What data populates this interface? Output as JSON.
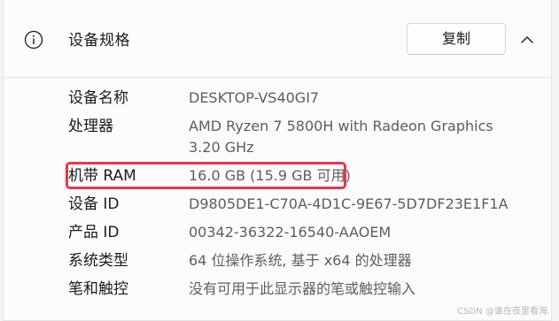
{
  "header": {
    "title": "设备规格",
    "copy_label": "复制",
    "info_icon": "info-icon",
    "collapse_icon": "chevron-up-icon"
  },
  "specs": [
    {
      "label": "设备名称",
      "value": "DESKTOP-VS40GI7"
    },
    {
      "label": "处理器",
      "value": "AMD Ryzen 7 5800H with Radeon Graphics",
      "value_line2": "3.20 GHz"
    },
    {
      "label": "机带 RAM",
      "value": "16.0 GB (15.9 GB 可用)"
    },
    {
      "label": "设备 ID",
      "value": "D9805DE1-C70A-4D1C-9E67-5D7DF23E1F1A"
    },
    {
      "label": "产品 ID",
      "value": "00342-36322-16540-AAOEM"
    },
    {
      "label": "系统类型",
      "value": "64 位操作系统, 基于 x64 的处理器"
    },
    {
      "label": "笔和触控",
      "value": "没有可用于此显示器的笔或触控输入"
    }
  ],
  "highlight_color": "#e8374d",
  "watermark": "CSDN @谁在夜里看海."
}
